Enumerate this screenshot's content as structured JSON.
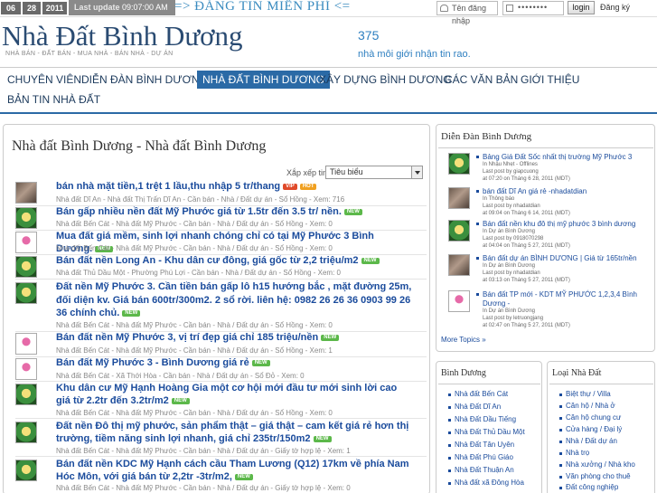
{
  "topbar": {
    "date_day": "06",
    "date_month": "28",
    "date_year": "2011",
    "last_update_label": "Last update",
    "last_update_value": "09:07:00 AM GMT",
    "promo": "=> ĐĂNG TIN MIỄN PHÍ <=",
    "username_placeholder": "Tên đăng nhập",
    "password_value": "••••••••",
    "login_label": "login",
    "register_label": "Đăng ký"
  },
  "header": {
    "logo": "Nhà Đất Bình Dương",
    "slogan": "NHÀ BÁN - ĐẤT BÁN - MUA NHÀ - BÁN NHÀ - DỰ ÁN",
    "counter": "375",
    "counter_text": "nhà môi giới nhận tin rao."
  },
  "nav": [
    {
      "label": "CHUYÊN VIÊN"
    },
    {
      "label": "DIỄN ĐÀN BÌNH DƯƠNG"
    },
    {
      "label": "NHÀ ĐẤT BÌNH DƯƠNG"
    },
    {
      "label": "XÂY DỰNG BÌNH DƯƠNG"
    },
    {
      "label": "CÁC VĂN BẢN"
    },
    {
      "label": "GIỚI THIỆU"
    },
    {
      "label": "BẢN TIN NHÀ ĐẤT"
    }
  ],
  "main": {
    "title": "Nhà đất Bình Dương - Nhà đất Bình Dương",
    "sort_label": "Xắp xếp tin",
    "sort_value": "Tiêu biểu",
    "topics": [
      {
        "title": "bán nhà mặt tiền,1 trệt 1 lầu,thu nhập 5 tr/thang",
        "badges": [
          "VIP",
          "HOT"
        ],
        "meta": "Nhà đất Dĩ An  -  Nhà đất Thị Trấn Dĩ An  -  Cần bán  -  Nhà / Đất dự án  -  Sổ Hồng  -  Xem: 716"
      },
      {
        "title": "Bán gấp nhiều nền đất Mỹ Phước giá từ 1.5tr đến 3.5 tr/ nền.",
        "badges": [
          "NEW"
        ],
        "meta": "Nhà đất Bến Cát  -  Nhà đất Mỹ Phước  -  Cần bán  -  Nhà / Đất dự án  -  Sổ Hồng  -  Xem: 0"
      },
      {
        "title": "Mua đất giá mềm, sinh lợi nhanh chóng chỉ có tại Mỹ Phước 3 Bình Dương.",
        "badges": [
          "NEW"
        ],
        "meta": "Nhà đất Bến Cát  -  Nhà đất Mỹ Phước  -  Cần bán  -  Nhà / Đất dự án  -  Sổ Hồng  -  Xem: 0"
      },
      {
        "title": "Bán đất nền Long An - Khu dân cư đông, giá gốc từ 2,2 triệu/m2",
        "badges": [
          "NEW"
        ],
        "meta": "Nhà đất Thủ Dầu Một  -  Phường Phú Lợi  -  Cần bán  -  Nhà / Đất dự án  -  Sổ Hồng  -  Xem: 0"
      },
      {
        "title": "Đất nền Mỹ Phước 3. Cần tiền bán gấp lô h15 hướng bắc , mặt đường 25m, đối diện kv. Giá bán 600tr/300m2. 2 sổ rời. liên hệ: 0982 26 26 36 0903 99 26 36 chính chủ.",
        "badges": [
          "NEW"
        ],
        "meta": "Nhà đất Bến Cát  -  Nhà đất Mỹ Phước  -  Cần bán  -  Nhà / Đất dự án  -  Sổ Hồng  -  Xem: 0"
      },
      {
        "title": "Bán đất nền Mỹ Phước 3, vị trí đẹp giá chỉ 185 triệu/nền",
        "badges": [
          "NEW"
        ],
        "meta": "Nhà đất Bến Cát  -  Nhà đất Mỹ Phước  -  Cần bán  -  Nhà / Đất dự án  -  Sổ Hồng  -  Xem: 1"
      },
      {
        "title": "Bán đất Mỹ Phước 3 - Bình Dương giá rẻ",
        "badges": [
          "NEW"
        ],
        "meta": "Nhà đất Bến Cát  -  Xã Thới Hòa  -  Cần bán  -  Nhà / Đất dự án  -  Sổ Đỏ  -  Xem: 0"
      },
      {
        "title": "Khu dân cư Mỹ Hạnh Hoàng Gia một cơ hội mới đầu tư mới sinh lời cao giá từ 2.2tr đến 3.2tr/m2",
        "badges": [
          "NEW"
        ],
        "meta": "Nhà đất Bến Cát  -  Nhà đất Mỹ Phước  -  Cần bán  -  Nhà / Đất dự án  -  Sổ Hồng  -  Xem: 0"
      },
      {
        "title": "Đất nền Đô thị mỹ phước, sản phẩm thật – giá thật – cam kết giá rẻ hơn thị trường, tiềm năng sinh lợi nhanh, giá chỉ 235tr/150m2",
        "badges": [
          "NEW"
        ],
        "meta": "Nhà đất Bến Cát  -  Nhà đất Mỹ Phước  -  Cần bán  -  Nhà / Đất dự án  -  Giấy tờ hợp lệ  -  Xem: 1"
      },
      {
        "title": "Bán đất nền KDC Mỹ Hạnh cách cầu Tham Lương (Q12) 17km về phía Nam Hóc Môn, với giá bán từ 2,2tr -3tr/m2,",
        "badges": [
          "NEW"
        ],
        "meta": "Nhà đất Bến Cát  -  Nhà đất Mỹ Phước  -  Cần bán  -  Nhà / Đất dự án  -  Giấy tờ hợp lệ  -  Xem: 0"
      }
    ]
  },
  "forum": {
    "title": "Diễn Đàn Bình Dương",
    "posts": [
      {
        "title": "Bảng Giá Đất Sốc nhất thị trường Mỹ Phước 3",
        "in": "In Nhậu Nhẹt - Offlines",
        "by": "Last post by giapcuong",
        "at": "at 07:20 on Tháng 6 28, 2011 (MDT)"
      },
      {
        "title": "bán đất Dĩ An giá rẻ -nhadatdian",
        "in": "In Thông báo",
        "by": "Last post by nhadatdian",
        "at": "at 09:04 on Tháng 6 14, 2011 (MDT)"
      },
      {
        "title": "Bán đất nền khu đô thị mỹ phước 3 bình dương",
        "in": "In Dự án Bình Dương",
        "by": "Last post by 0918070298",
        "at": "at 04:04 on Tháng 5 27, 2011 (MDT)"
      },
      {
        "title": "Bán đất dự án BÌNH DƯƠNG | Giá từ 165tr/nền",
        "in": "In Dự án Bình Dương",
        "by": "Last post by nhadatdian",
        "at": "at 03:13 on Tháng 5 27, 2011 (MDT)"
      },
      {
        "title": "Bán đất TP mới - KDT MỸ PHƯỚC 1,2,3,4 Bình Dương -",
        "in": "In Dự án Bình Dương",
        "by": "Last post by letruongjang",
        "at": "at 02:47 on Tháng 5 27, 2011 (MDT)"
      }
    ],
    "more": "More Topics »"
  },
  "binhduong": {
    "title": "Bình Dương",
    "links": [
      "Nhà đất Bến Cát",
      "Nhà Đất Dĩ An",
      "Nhà Đất Dầu Tiếng",
      "Nhà Đất Thủ Dầu Một",
      "Nhà Đất Tân Uyên",
      "Nhà Đất Phú Giáo",
      "Nhà Đất Thuận An",
      "Nhà đất xã Đông Hòa"
    ]
  },
  "loainhadat": {
    "title": "Loại Nhà Đất",
    "links": [
      "Biệt thự / Villa",
      "Căn hộ / Nhà ở",
      "Căn hộ chung cư",
      "Cửa hàng / Đại lý",
      "Nhà / Đất dự án",
      "Nhà trọ",
      "Nhà xưởng / Nhà kho",
      "Văn phòng cho thuê",
      "Đất công nghiệp"
    ]
  },
  "colors": {
    "accent": "#2b6aa6",
    "link": "#1a4b9c",
    "promo": "#3a8bbf",
    "new_badge": "#5cb84a"
  }
}
